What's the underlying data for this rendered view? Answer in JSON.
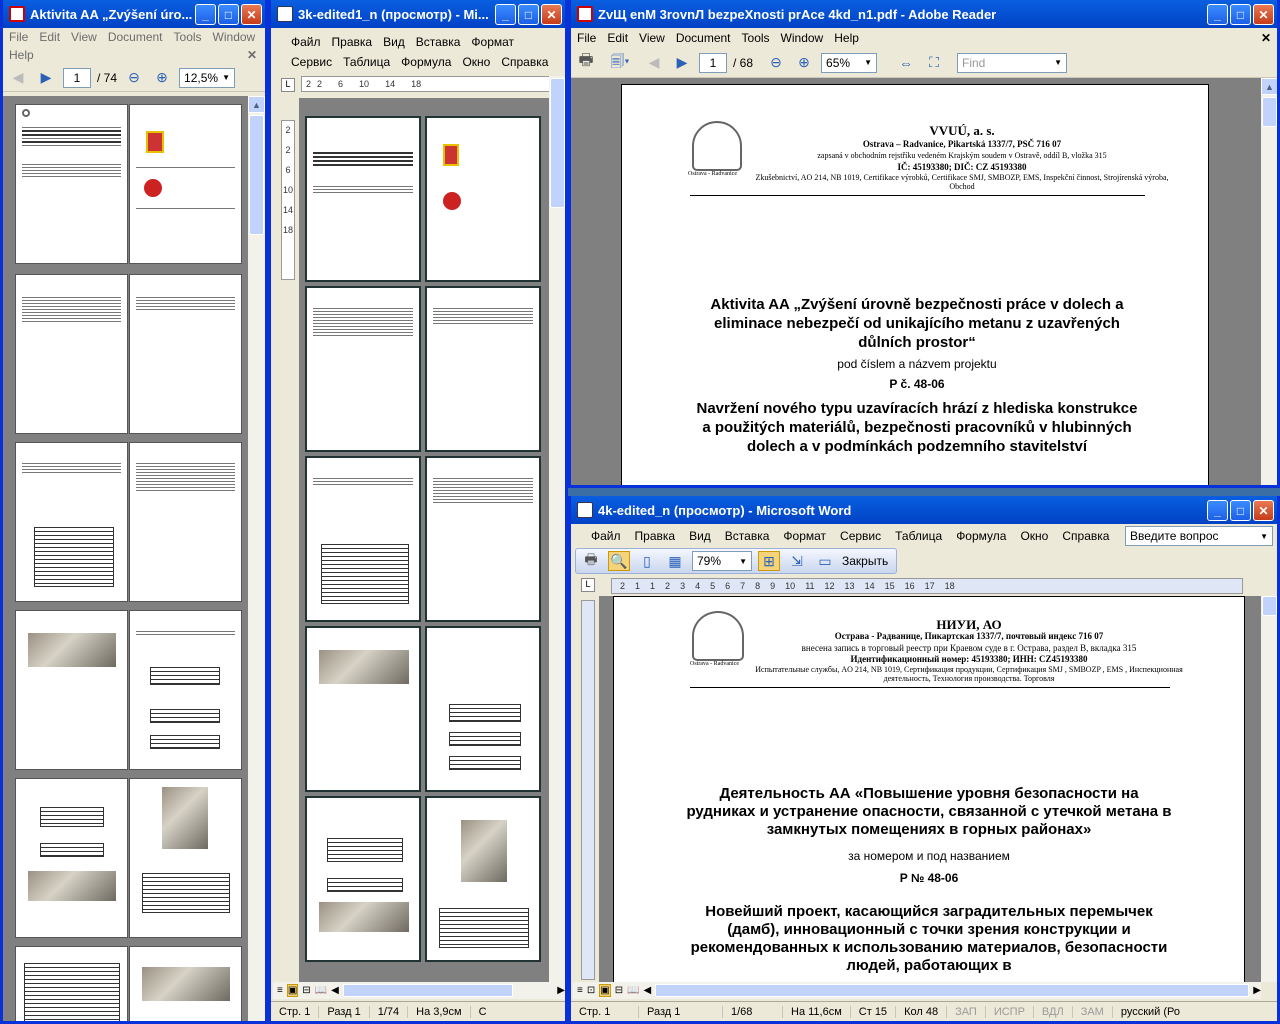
{
  "win1": {
    "title": "Aktivita AA „Zvýšení úro...",
    "menu": [
      "File",
      "Edit",
      "View",
      "Document",
      "Tools",
      "Window",
      "Help"
    ],
    "page_num": "1",
    "page_total": "/ 74",
    "zoom": "12,5%"
  },
  "win2": {
    "title": "3k-edited1_n (просмотр) - Mi...",
    "menu_row1": [
      "Файл",
      "Правка",
      "Вид",
      "Вставка",
      "Формат"
    ],
    "menu_row2": [
      "Сервис",
      "Таблица",
      "Формула",
      "Окно",
      "Справка"
    ],
    "ruler": [
      "2",
      "2",
      "6",
      "10",
      "14",
      "18"
    ],
    "vruler": [
      "2",
      "2",
      "6",
      "10",
      "14",
      "18"
    ],
    "status": {
      "page": "Стр. 1",
      "section": "Разд 1",
      "pages": "1/74",
      "pos": "На 3,9см",
      "extra": "С"
    }
  },
  "win3": {
    "title": "ZvЩ enM 3rovnЛ bezpeXnosti prAce 4kd_n1.pdf - Adobe Reader",
    "menu": [
      "File",
      "Edit",
      "View",
      "Document",
      "Tools",
      "Window",
      "Help"
    ],
    "page_num": "1",
    "page_total": "/ 68",
    "zoom": "65%",
    "find_placeholder": "Find",
    "doc": {
      "company": "VVUÚ, a. s.",
      "address": "Ostrava – Radvanice, Pikartská 1337/7, PSČ 716 07",
      "register": "zapsaná v obchodním rejstříku vedeném Krajským soudem v Ostravě, oddíl B, vložka 315",
      "ids": "IČ: 45193380; DIČ: CZ 45193380",
      "services": "Zkušebnictví, AO 214, NB 1019, Certifikace výrobků, Certifikace SMJ, SMBOZP, EMS, Inspekční činnost, Strojírenská výroba, Obchod",
      "logo_caption": "Ostrava - Radvanice",
      "heading": "Aktivita AA „Zvýšení úrovně bezpečnosti práce v dolech a eliminace nebezpečí od unikajícího metanu z uzavřených důlních prostor“",
      "sub": "pod číslem a názvem projektu",
      "project": "P č. 48-06",
      "title2": "Navržení nového typu uzavíracích hrází z hlediska konstrukce a použitých materiálů, bezpečnosti pracovníků v hlubinných dolech a v podmínkách podzemního stavitelství"
    }
  },
  "win4": {
    "title": "4k-edited_n (просмотр) - Microsoft Word",
    "menu": [
      "Файл",
      "Правка",
      "Вид",
      "Вставка",
      "Формат",
      "Сервис",
      "Таблица",
      "Формула",
      "Окно",
      "Справка"
    ],
    "ask_placeholder": "Введите вопрос",
    "zoom": "79%",
    "close_label": "Закрыть",
    "ruler": [
      "2",
      "1",
      "1",
      "2",
      "3",
      "4",
      "5",
      "6",
      "7",
      "8",
      "9",
      "10",
      "11",
      "12",
      "13",
      "14",
      "15",
      "16",
      "17",
      "18"
    ],
    "doc": {
      "company": "НИУИ, АО",
      "address": "Острава - Радванице, Пикартская 1337/7, почтовый индекс 716 07",
      "register": "внесена запись в торговый реестр при Краевом суде в г. Острава, раздел B, вкладка 315",
      "ids": "Идентификационный номер:  45193380;  ИНН: CZ45193380",
      "services": "Испытательные службы, AO 214, NB 1019, Сертификация продукции, Сертификация SMJ , SMBOZP , EMS , Инспекционная деятельность, Технология производства. Торговля",
      "logo_caption": "Ostrava - Radvanice",
      "heading": "Деятельность АА «Повышение уровня безопасности на рудниках и устранение опасности, связанной с утечкой метана в замкнутых помещениях в горных районах»",
      "sub": "за номером и под названием",
      "project": "P № 48-06",
      "title2": "Новейший проект, касающийся заградительных перемычек (дамб), инновационный с точки зрения конструкции и рекомендованных к использованию материалов, безопасности людей, работающих в"
    },
    "status": {
      "page": "Стр. 1",
      "section": "Разд 1",
      "pages": "1/68",
      "pos": "На 11,6см",
      "line": "Ст 15",
      "col": "Кол 48",
      "rec": "ЗАП",
      "trk": "ИСПР",
      "ext": "ВДЛ",
      "ovr": "ЗАМ",
      "lang": "русский (Ро"
    }
  }
}
